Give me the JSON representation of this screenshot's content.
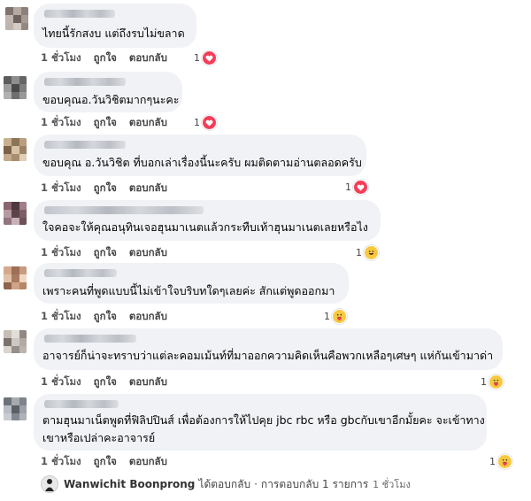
{
  "colors": {
    "bubble": "#f0f2f5",
    "heart": "#f33e58",
    "emoji": "#f7c940"
  },
  "comments": [
    {
      "text": [
        "ไทยนี้รักสงบ แต่ถึงรบไม่ขลาด"
      ],
      "time": "1 ชั่วโมง",
      "like": "ถูกใจ",
      "reply": "ตอบกลับ",
      "reaction_count": "1",
      "reaction": "heart-icon"
    },
    {
      "text": [
        "ขอบคุณอ.วันวิชิตมากๆนะคะ"
      ],
      "time": "1 ชั่วโมง",
      "like": "ถูกใจ",
      "reply": "ตอบกลับ",
      "reaction_count": "1",
      "reaction": "heart-icon"
    },
    {
      "text": [
        "ขอบคุณ อ.วันวิชิต ที่บอกเล่าเรื่องนี้นะครับ ผมติดตามอ่านตลอดครับ"
      ],
      "time": "1 ชั่วโมง",
      "like": "ถูกใจ",
      "reply": "ตอบกลับ",
      "reaction_count": "1",
      "reaction": "heart-icon"
    },
    {
      "text": [
        "ใจคอจะให้คุณอนุทินเจอฮุนมาเนตแล้วกระทืบเท้าฮุนมาเนตเลยหรือไง"
      ],
      "time": "1 ชั่วโมง",
      "like": "ถูกใจ",
      "reply": "ตอบกลับ",
      "reaction_count": "1",
      "reaction": "haha-icon"
    },
    {
      "text": [
        "เพราะคนที่พูดแบบนี้ไม่เข้าใจบริบทใดๆเลยค่ะ สักแต่พูดออกมา"
      ],
      "time": "1 ชั่วโมง",
      "like": "ถูกใจ",
      "reply": "ตอบกลับ",
      "reaction_count": "1",
      "reaction": "care-icon"
    },
    {
      "text": [
        "อาจารย์ก็น่าจะทราบว่าแต่ละคอมเม้นท์ที่มาออกความคิดเห็นคือพวกเหลือๆเศษๆ แห่กันเข้ามาด่า"
      ],
      "time": "1 ชั่วโมง",
      "like": "ถูกใจ",
      "reply": "ตอบกลับ",
      "reaction_count": "1",
      "reaction": "care-icon"
    },
    {
      "text": [
        "ตามฮุนมาเน็ตพูดที่ฟิลิปปินส์ เพื่อต้องการให้ไปคุย jbc rbc หรือ gbcกับเขาอีกมั้ยคะ จะเข้าทาง",
        "เขาหรือเปล่าคะอาจารย์"
      ],
      "time": "1 ชั่วโมง",
      "like": "ถูกใจ",
      "reply": "ตอบกลับ",
      "reaction_count": "1",
      "reaction": "care-icon"
    }
  ],
  "footer": {
    "author": "Wanwichit Boonprong",
    "replied": "ได้ตอบกลับ",
    "sep": "·",
    "replies": "การตอบกลับ 1 รายการ",
    "time": "1 ชั่วโมง"
  }
}
